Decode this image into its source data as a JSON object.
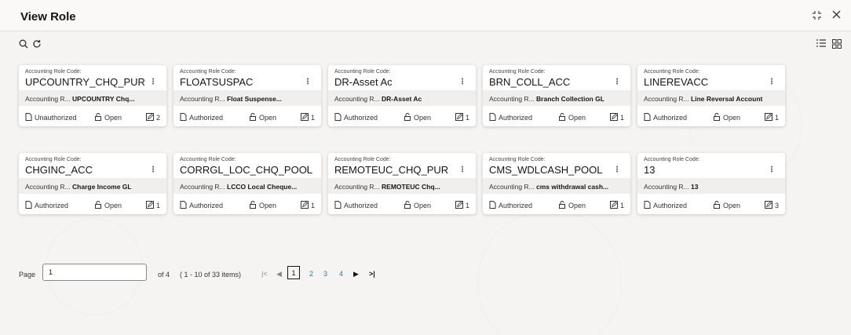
{
  "header": {
    "title": "View Role"
  },
  "toolbar": {
    "search_icon": "search-icon",
    "refresh_icon": "refresh-icon"
  },
  "view_toggle": {
    "list_icon": "list-view-icon",
    "grid_icon": "grid-view-icon"
  },
  "cards": [
    {
      "label": "Accounting Role Code:",
      "code": "UPCOUNTRY_CHQ_PUR",
      "desc_label": "Accounting R...",
      "desc_value": "UPCOUNTRY Chq...",
      "auth": "Unauthorized",
      "record": "Open",
      "mod": "2"
    },
    {
      "label": "Accounting Role Code:",
      "code": "FLOATSUSPAC",
      "desc_label": "Accounting R...",
      "desc_value": "Float Suspense...",
      "auth": "Authorized",
      "record": "Open",
      "mod": "1"
    },
    {
      "label": "Accounting Role Code:",
      "code": "DR-Asset Ac",
      "desc_label": "Accounting R...",
      "desc_value": "DR-Asset Ac",
      "auth": "Authorized",
      "record": "Open",
      "mod": "1"
    },
    {
      "label": "Accounting Role Code:",
      "code": "BRN_COLL_ACC",
      "desc_label": "Accounting R...",
      "desc_value": "Branch Collection GL",
      "auth": "Authorized",
      "record": "Open",
      "mod": "1"
    },
    {
      "label": "Accounting Role Code:",
      "code": "LINEREVACC",
      "desc_label": "Accounting R...",
      "desc_value": "Line Reversal Account",
      "auth": "Authorized",
      "record": "Open",
      "mod": "1"
    },
    {
      "label": "Accounting Role Code:",
      "code": "CHGINC_ACC",
      "desc_label": "Accounting R...",
      "desc_value": "Charge Income GL",
      "auth": "Authorized",
      "record": "Open",
      "mod": "1"
    },
    {
      "label": "Accounting Role Code:",
      "code": "CORRGL_LOC_CHQ_POOL",
      "desc_label": "Accounting R...",
      "desc_value": "LCCO Local Cheque...",
      "auth": "Authorized",
      "record": "Open",
      "mod": "1"
    },
    {
      "label": "Accounting Role Code:",
      "code": "REMOTEUC_CHQ_PUR",
      "desc_label": "Accounting R...",
      "desc_value": "REMOTEUC Chq...",
      "auth": "Authorized",
      "record": "Open",
      "mod": "1"
    },
    {
      "label": "Accounting Role Code:",
      "code": "CMS_WDLCASH_POOL",
      "desc_label": "Accounting R...",
      "desc_value": "cms withdrawal cash...",
      "auth": "Authorized",
      "record": "Open",
      "mod": "1"
    },
    {
      "label": "Accounting Role Code:",
      "code": "13",
      "desc_label": "Accounting R...",
      "desc_value": "13",
      "auth": "Authorized",
      "record": "Open",
      "mod": "3"
    }
  ],
  "pager": {
    "page_label": "Page",
    "page_value": "1",
    "of_text": "of 4",
    "items_text": "( 1 - 10 of 33 items)",
    "pages": [
      "1",
      "2",
      "3",
      "4"
    ]
  }
}
